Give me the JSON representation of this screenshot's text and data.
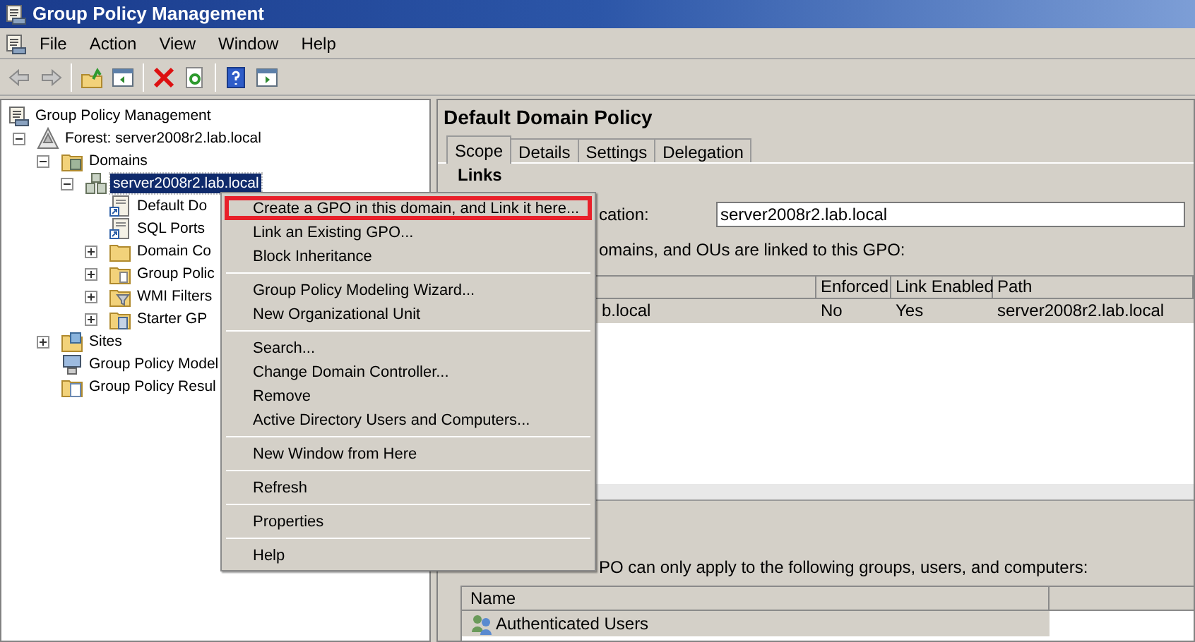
{
  "window": {
    "title": "Group Policy Management"
  },
  "menu_bar": [
    "File",
    "Action",
    "View",
    "Window",
    "Help"
  ],
  "tree": [
    {
      "label": "Group Policy Management",
      "kind": "console",
      "selected": false,
      "children": [
        {
          "label": "Forest: server2008r2.lab.local",
          "kind": "forest",
          "selected": false,
          "expanded": true,
          "children": [
            {
              "label": "Domains",
              "kind": "domains",
              "selected": false,
              "expanded": true,
              "children": [
                {
                  "label": "server2008r2.lab.local",
                  "kind": "domain",
                  "selected": true,
                  "expanded": true,
                  "children": [
                    {
                      "label": "Default Do",
                      "kind": "gpo-link",
                      "selected": false
                    },
                    {
                      "label": "SQL Ports",
                      "kind": "gpo-link",
                      "selected": false
                    },
                    {
                      "label": "Domain Co",
                      "kind": "ou",
                      "selected": false,
                      "expanded": false
                    },
                    {
                      "label": "Group Polic",
                      "kind": "folder",
                      "selected": false,
                      "expanded": false
                    },
                    {
                      "label": "WMI Filters",
                      "kind": "filter",
                      "selected": false,
                      "expanded": false
                    },
                    {
                      "label": "Starter GP",
                      "kind": "starter",
                      "selected": false,
                      "expanded": false
                    }
                  ]
                }
              ]
            },
            {
              "label": "Sites",
              "kind": "sites",
              "selected": false,
              "expanded": false
            },
            {
              "label": "Group Policy Model",
              "kind": "modeling",
              "selected": false
            },
            {
              "label": "Group Policy Resul",
              "kind": "results",
              "selected": false
            }
          ]
        }
      ]
    }
  ],
  "details": {
    "title": "Default Domain Policy",
    "tabs": [
      {
        "label": "Scope",
        "selected": true
      },
      {
        "label": "Details",
        "selected": false
      },
      {
        "label": "Settings",
        "selected": false
      },
      {
        "label": "Delegation",
        "selected": false
      }
    ],
    "links_heading": "Links",
    "location_label": "cation:",
    "location_value": "server2008r2.lab.local",
    "links_caption": "omains, and OUs are linked to this GPO:",
    "links_table": {
      "columns": [
        "",
        "Enforced",
        "Link Enabled",
        "Path"
      ],
      "rows": [
        {
          "cells": [
            "b.local",
            "No",
            "Yes",
            "server2008r2.lab.local"
          ]
        }
      ]
    },
    "filtering_caption": "PO can only apply to the following groups, users, and computers:",
    "filtering_table": {
      "columns": [
        "Name"
      ],
      "rows": [
        {
          "cells": [
            "Authenticated Users"
          ]
        }
      ]
    }
  },
  "context_menu": {
    "groups": [
      [
        {
          "label": "Create a GPO in this domain, and Link it here...",
          "selected": true
        },
        {
          "label": "Link an Existing GPO...",
          "selected": false
        },
        {
          "label": "Block Inheritance",
          "selected": false
        }
      ],
      [
        {
          "label": "Group Policy Modeling Wizard...",
          "selected": false
        },
        {
          "label": "New Organizational Unit",
          "selected": false
        }
      ],
      [
        {
          "label": "Search...",
          "selected": false
        },
        {
          "label": "Change Domain Controller...",
          "selected": false
        },
        {
          "label": "Remove",
          "selected": false
        },
        {
          "label": "Active Directory Users and Computers...",
          "selected": false
        }
      ],
      [
        {
          "label": "New Window from Here",
          "selected": false
        }
      ],
      [
        {
          "label": "Refresh",
          "selected": false
        }
      ],
      [
        {
          "label": "Properties",
          "selected": false
        }
      ],
      [
        {
          "label": "Help",
          "selected": false
        }
      ]
    ]
  }
}
